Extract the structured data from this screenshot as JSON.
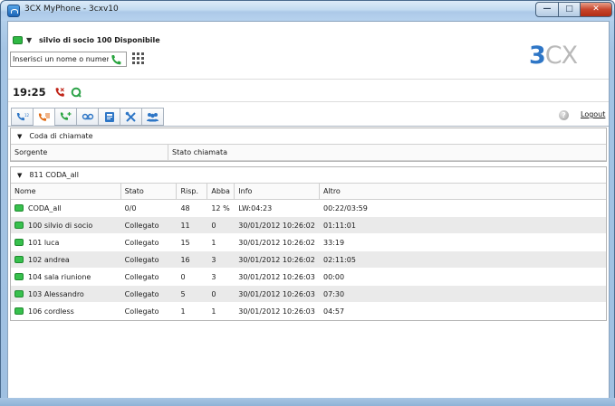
{
  "window": {
    "title": "3CX MyPhone - 3cxv10"
  },
  "header": {
    "user_status": "silvio di socio 100 Disponibile",
    "search_placeholder": "Inserisci un nome o numero",
    "logo_part1": "3",
    "logo_part2": "CX",
    "clock": "19:25",
    "status_color": "#2fb944",
    "accent_color": "#2e76c6"
  },
  "toolbar": {
    "tabs": [
      {
        "icon": "phone-dialer-icon"
      },
      {
        "icon": "call-queue-icon"
      },
      {
        "icon": "add-call-icon"
      },
      {
        "icon": "voicemail-icon"
      },
      {
        "icon": "phonebook-icon"
      },
      {
        "icon": "settings-tools-icon"
      },
      {
        "icon": "users-icon"
      }
    ],
    "help_label": "?",
    "logout_label": "Logout"
  },
  "queue_section": {
    "title": "Coda di chiamate",
    "columns": [
      "Sorgente",
      "Stato chiamata"
    ]
  },
  "agents_section": {
    "title": "811 CODA_all",
    "columns": [
      "Nome",
      "Stato",
      "Risp.",
      "Abba",
      "Info",
      "Altro"
    ],
    "rows": [
      [
        "CODA_all",
        "0/0",
        "48",
        "12 %",
        "LW:04:23",
        "00:22/03:59"
      ],
      [
        "100 silvio di socio",
        "Collegato",
        "11",
        "0",
        "30/01/2012 10:26:02",
        "01:11:01"
      ],
      [
        "101 luca",
        "Collegato",
        "15",
        "1",
        "30/01/2012 10:26:02",
        "33:19"
      ],
      [
        "102 andrea",
        "Collegato",
        "16",
        "3",
        "30/01/2012 10:26:02",
        "02:11:05"
      ],
      [
        "104 sala riunione",
        "Collegato",
        "0",
        "3",
        "30/01/2012 10:26:03",
        "00:00"
      ],
      [
        "103 Alessandro",
        "Collegato",
        "5",
        "0",
        "30/01/2012 10:26:03",
        "07:30"
      ],
      [
        "106 cordless",
        "Collegato",
        "1",
        "1",
        "30/01/2012 10:26:03",
        "04:57"
      ]
    ]
  }
}
